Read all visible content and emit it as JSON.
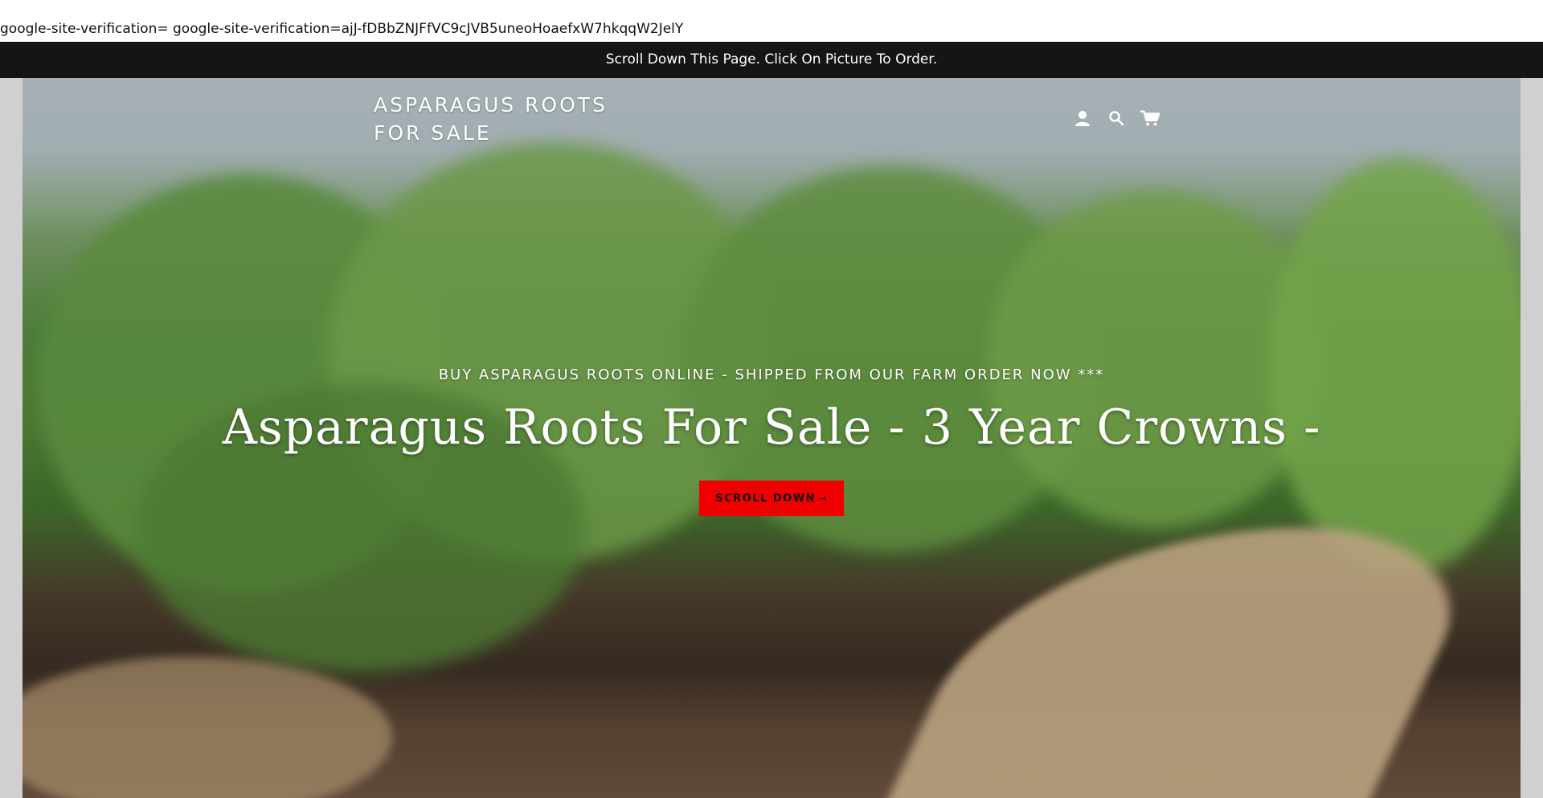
{
  "meta_text": "google-site-verification= google-site-verification=ajJ-fDBbZNJFfVC9cJVB5uneoHoaefxW7hkqqW2JelY",
  "announcement": {
    "text": "Scroll Down This Page. Click On Picture To Order."
  },
  "header": {
    "logo_text": "ASPARAGUS ROOTS FOR SALE",
    "icons": [
      "account-icon",
      "search-icon",
      "cart-icon"
    ]
  },
  "hero": {
    "subtitle": "BUY ASPARAGUS ROOTS ONLINE - SHIPPED FROM OUR FARM ORDER NOW ***",
    "headline": "Asparagus Roots For Sale - 3 Year Crowns -",
    "cta_label": "SCROLL DOWN",
    "cta_arrow": "→",
    "image_description_tag": "asparagus-field-photo"
  },
  "colors": {
    "announcement_bg": "#151515",
    "cta_bg": "#ee0000",
    "text_light": "#ffffff"
  }
}
